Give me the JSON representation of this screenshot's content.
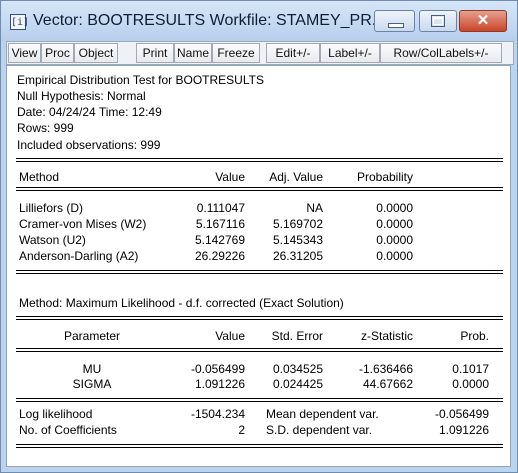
{
  "window": {
    "app_icon_glyph": "[i]",
    "title": "Vector: BOOTRESULTS   Workfile: STAMEY_PR...",
    "close_glyph": "✕"
  },
  "toolbar": {
    "buttons": [
      "View",
      "Proc",
      "Object",
      "Print",
      "Name",
      "Freeze",
      "Edit+/-",
      "Label+/-",
      "Row/ColLabels+/-"
    ]
  },
  "header": {
    "lines": [
      "Empirical Distribution Test for BOOTRESULTS",
      "Null Hypothesis: Normal",
      "Date: 04/24/24   Time: 12:49",
      "Rows: 999",
      "Included observations: 999"
    ]
  },
  "table1": {
    "columns": [
      "Method",
      "Value",
      "Adj. Value",
      "Probability"
    ],
    "rows": [
      [
        "Lilliefors (D)",
        "0.111047",
        "NA",
        "0.0000"
      ],
      [
        "Cramer-von Mises (W2)",
        "5.167116",
        "5.169702",
        "0.0000"
      ],
      [
        "Watson (U2)",
        "5.142769",
        "5.145343",
        "0.0000"
      ],
      [
        "Anderson-Darling (A2)",
        "26.29226",
        "26.31205",
        "0.0000"
      ]
    ]
  },
  "method_line": "Method: Maximum Likelihood - d.f. corrected (Exact Solution)",
  "table2": {
    "columns": [
      "Parameter",
      "Value",
      "Std. Error",
      "z-Statistic",
      "Prob."
    ],
    "rows": [
      [
        "MU",
        "-0.056499",
        "0.034525",
        "-1.636466",
        "0.1017"
      ],
      [
        "SIGMA",
        "1.091226",
        "0.024425",
        "44.67662",
        "0.0000"
      ]
    ]
  },
  "stats": {
    "rows": [
      [
        "Log likelihood",
        "-1504.234",
        "Mean dependent var.",
        "-0.056499"
      ],
      [
        "No. of Coefficients",
        "2",
        "S.D. dependent var.",
        "1.091226"
      ]
    ]
  }
}
